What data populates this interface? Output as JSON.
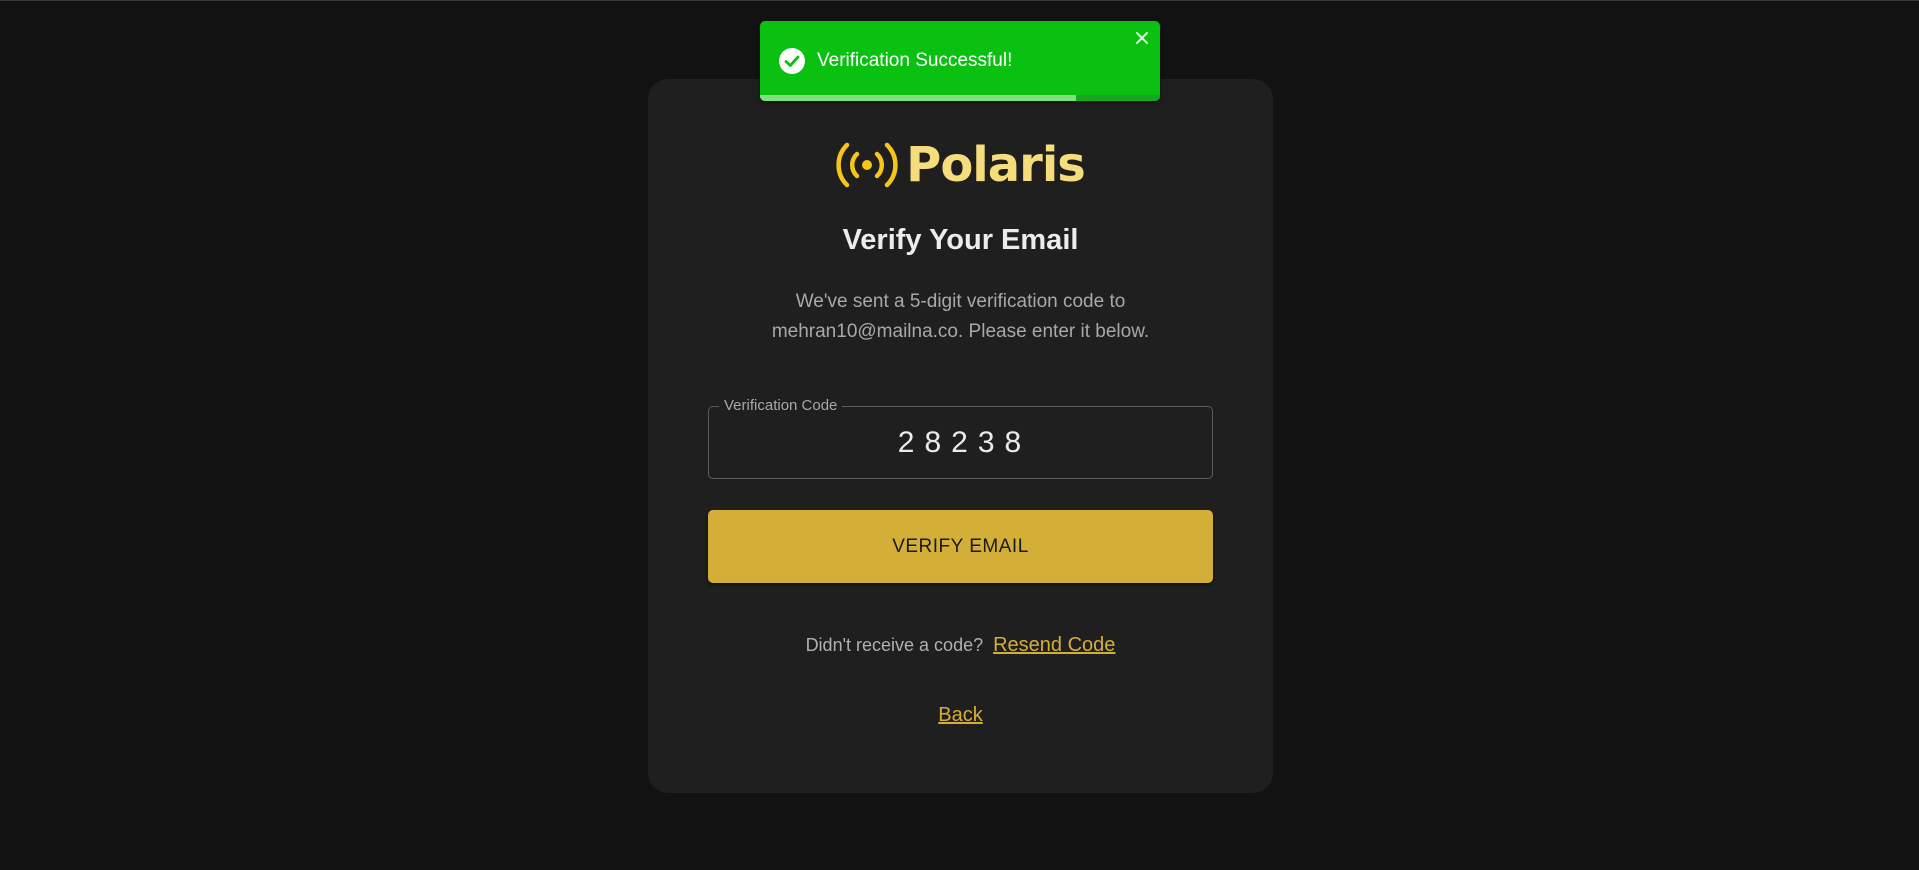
{
  "toast": {
    "message": "Verification Successful!",
    "icon": "check-circle-icon",
    "close_icon": "close-icon",
    "color": "#0ac011",
    "progress": 0.79
  },
  "brand": {
    "name": "Polaris",
    "icon": "broadcast-icon",
    "icon_color": "#f5c518",
    "text_color": "#f5dc7c"
  },
  "form": {
    "title": "Verify Your Email",
    "subtitle_line1": "We've sent a 5-digit verification code to",
    "subtitle_line2": "mehran10@mailna.co. Please enter it below.",
    "code_label": "Verification Code",
    "code_value": "28238",
    "verify_label": "VERIFY EMAIL",
    "resend_prompt": "Didn't receive a code?",
    "resend_link": "Resend Code",
    "back_link": "Back"
  },
  "colors": {
    "background": "#121212",
    "card": "#1f1f1f",
    "accent": "#d4af37"
  }
}
